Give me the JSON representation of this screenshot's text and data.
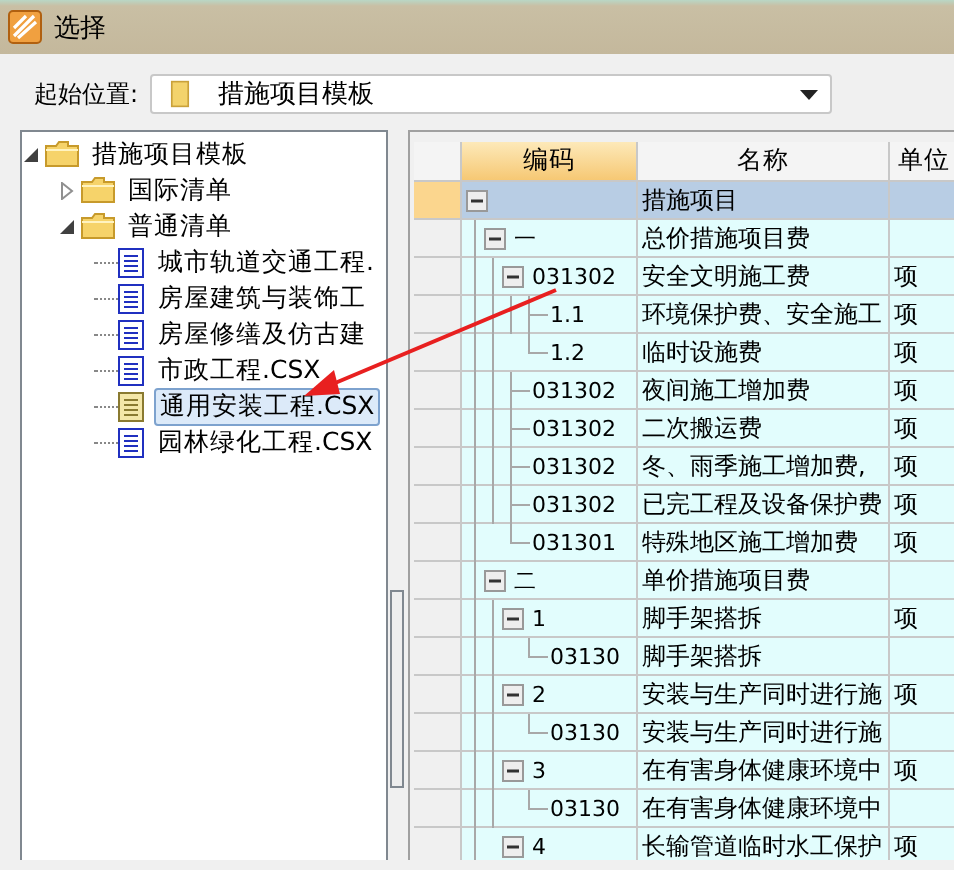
{
  "window": {
    "title": "选择"
  },
  "start": {
    "label": "起始位置:",
    "value": "措施项目模板"
  },
  "tree": {
    "items": [
      {
        "label": "措施项目模板",
        "kind": "folder",
        "expanded": true,
        "selected": false,
        "children": [
          {
            "label": "国际清单",
            "kind": "folder",
            "expanded": false,
            "selected": false
          },
          {
            "label": "普通清单",
            "kind": "folder",
            "expanded": true,
            "selected": false,
            "children": [
              {
                "label": "城市轨道交通工程.",
                "kind": "file",
                "selected": false
              },
              {
                "label": "房屋建筑与装饰工",
                "kind": "file",
                "selected": false
              },
              {
                "label": "房屋修缮及仿古建",
                "kind": "file",
                "selected": false
              },
              {
                "label": "市政工程.CSX",
                "kind": "file",
                "selected": false
              },
              {
                "label": "通用安装工程.CSX",
                "kind": "file",
                "selected": true
              },
              {
                "label": "园林绿化工程.CSX",
                "kind": "file",
                "selected": false
              }
            ]
          }
        ]
      }
    ]
  },
  "grid": {
    "columns": [
      "编码",
      "名称",
      "单位"
    ],
    "rows": [
      {
        "code": "",
        "name": "措施项目",
        "expanded": true,
        "selected": true,
        "children": [
          {
            "code": "一",
            "name": "总价措施项目费",
            "expanded": true,
            "selected": false,
            "children": [
              {
                "code": "031302",
                "name": "安全文明施工费",
                "unit": "项",
                "expanded": true,
                "selected": false,
                "children": [
                  {
                    "code": "1.1",
                    "name": "环境保护费、安全施工",
                    "unit": "项",
                    "selected": false
                  },
                  {
                    "code": "1.2",
                    "name": "临时设施费",
                    "unit": "项",
                    "selected": false
                  }
                ]
              },
              {
                "code": "031302",
                "name": "夜间施工增加费",
                "unit": "项",
                "selected": false
              },
              {
                "code": "031302",
                "name": "二次搬运费",
                "unit": "项",
                "selected": false
              },
              {
                "code": "031302",
                "name": "冬、雨季施工增加费,",
                "unit": "项",
                "selected": false
              },
              {
                "code": "031302",
                "name": "已完工程及设备保护费",
                "unit": "项",
                "selected": false
              },
              {
                "code": "031301",
                "name": "特殊地区施工增加费",
                "unit": "项",
                "selected": false
              }
            ]
          },
          {
            "code": "二",
            "name": "单价措施项目费",
            "expanded": true,
            "selected": false,
            "children": [
              {
                "code": "1",
                "name": "脚手架搭拆",
                "unit": "项",
                "expanded": true,
                "selected": false,
                "children": [
                  {
                    "code": "03130",
                    "name": "脚手架搭拆",
                    "selected": false
                  }
                ]
              },
              {
                "code": "2",
                "name": "安装与生产同时进行施",
                "unit": "项",
                "expanded": true,
                "selected": false,
                "children": [
                  {
                    "code": "03130",
                    "name": "安装与生产同时进行施",
                    "selected": false
                  }
                ]
              },
              {
                "code": "3",
                "name": "在有害身体健康环境中",
                "unit": "项",
                "expanded": true,
                "selected": false,
                "children": [
                  {
                    "code": "03130",
                    "name": "在有害身体健康环境中",
                    "selected": false
                  }
                ]
              },
              {
                "code": "4",
                "name": "长输管道临时水工保护",
                "unit": "项",
                "expanded": true,
                "selected": false
              }
            ]
          }
        ]
      }
    ]
  }
}
